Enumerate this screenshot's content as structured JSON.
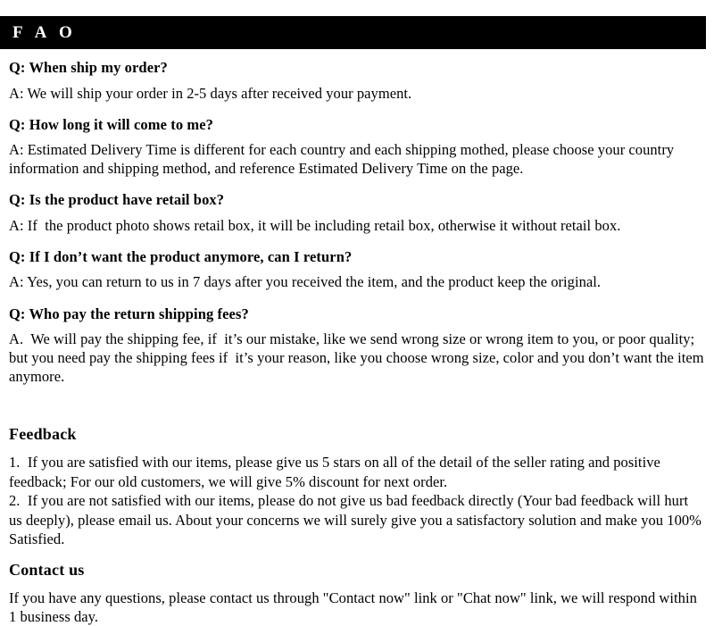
{
  "header": {
    "title": "F A O"
  },
  "faq": {
    "items": [
      {
        "question": "Q: When ship my order?",
        "answer": "A: We will ship your order in 2-5 days after received your payment."
      },
      {
        "question": "Q: How long it will come to me?",
        "answer": "A: Estimated Delivery Time is different for each country and each shipping mothed, please choose your country information and shipping method, and reference Estimated Delivery Time on the page."
      },
      {
        "question": "Q: Is the product have retail box?",
        "answer": "A: If  the product photo shows retail box, it will be including retail box, otherwise it without retail box."
      },
      {
        "question": "Q: If  I don’t want the product anymore, can I return?",
        "answer": "A: Yes, you can return to us in 7 days after you received the item, and the product keep the original."
      },
      {
        "question": "Q: Who pay the return shipping fees?",
        "answer": "A.  We will pay the shipping fee, if  it’s our mistake, like we send wrong size or wrong item to you, or poor quality; but you need pay the shipping fees if  it’s your reason, like you choose wrong size, color and you don’t want the item anymore."
      }
    ]
  },
  "feedback": {
    "heading": "Feedback",
    "items": [
      "1.  If you are satisfied with our items, please give us 5 stars on all of the detail of the seller rating and positive feedback; For our old customers, we will give 5% discount for next order.",
      "2.  If you are not satisfied with our items, please do not give us bad feedback directly (Your bad feedback will hurt us deeply), please email us. About your concerns we will surely give you a satisfactory solution and make you 100% Satisfied."
    ]
  },
  "contact": {
    "heading": "Contact us",
    "text": "If you have any questions, please contact us through \"Contact now\" link or \"Chat now\" link, we will respond within 1 business day."
  }
}
